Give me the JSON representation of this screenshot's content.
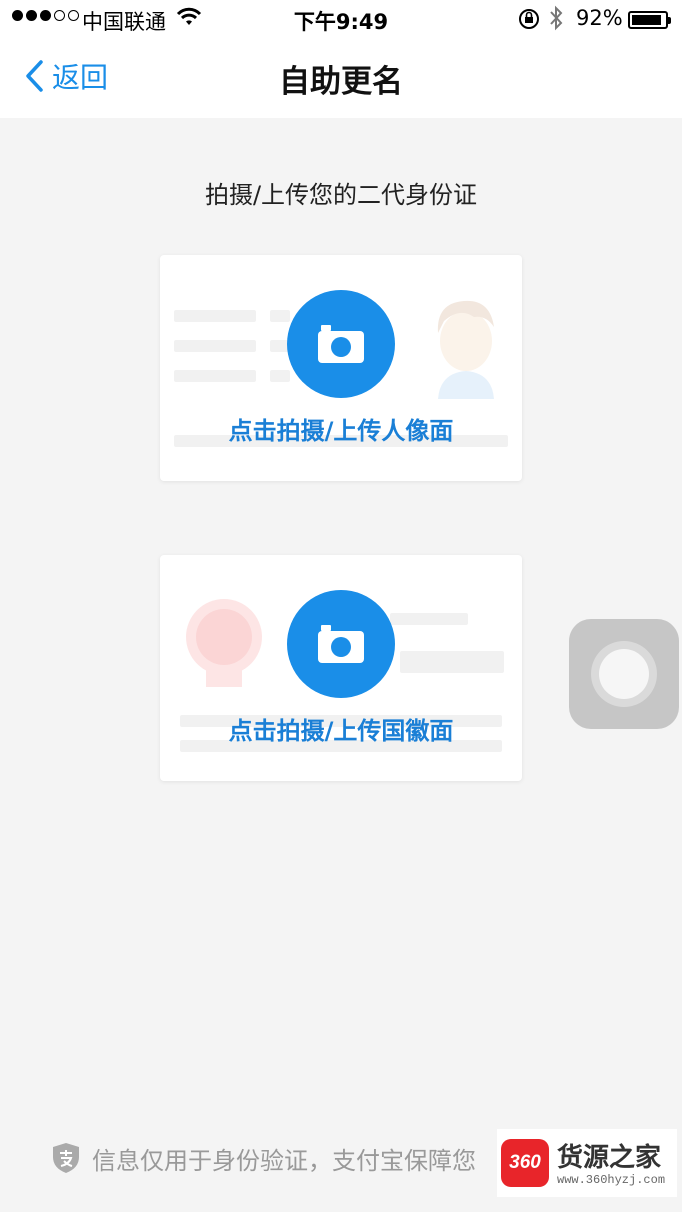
{
  "status_bar": {
    "carrier": "中国联通",
    "time": "下午9:49",
    "battery": "92%",
    "battery_level": 0.92
  },
  "nav": {
    "back_label": "返回",
    "title": "自助更名"
  },
  "instruction": "拍摄/上传您的二代身份证",
  "cards": {
    "front_label": "点击拍摄/上传人像面",
    "back_label": "点击拍摄/上传国徽面"
  },
  "footer": {
    "note": "信息仅用于身份验证，支付宝保障您"
  },
  "watermark": {
    "logo": "360",
    "name": "货源之家",
    "url": "www.360hyzj.com"
  },
  "colors": {
    "accent": "#1a8ee8",
    "background": "#f4f4f4"
  }
}
